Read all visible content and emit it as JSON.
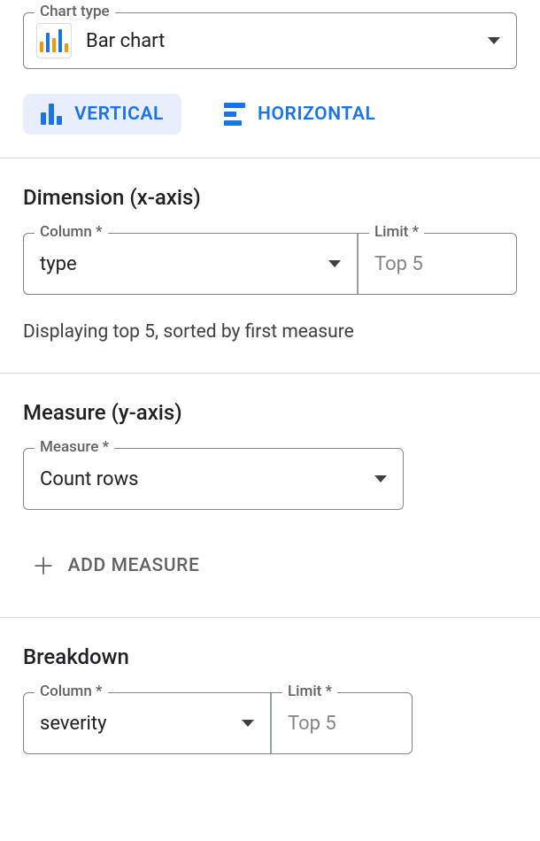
{
  "chartType": {
    "label": "Chart type",
    "value": "Bar chart"
  },
  "tabs": {
    "vertical": "VERTICAL",
    "horizontal": "HORIZONTAL"
  },
  "dimension": {
    "title": "Dimension (x-axis)",
    "columnLabel": "Column *",
    "columnValue": "type",
    "limitLabel": "Limit *",
    "limitValue": "Top 5",
    "note": "Displaying top 5, sorted by first measure"
  },
  "measure": {
    "title": "Measure (y-axis)",
    "label": "Measure *",
    "value": "Count rows",
    "addLabel": "ADD MEASURE"
  },
  "breakdown": {
    "title": "Breakdown",
    "columnLabel": "Column *",
    "columnValue": "severity",
    "limitLabel": "Limit *",
    "limitValue": "Top 5"
  }
}
